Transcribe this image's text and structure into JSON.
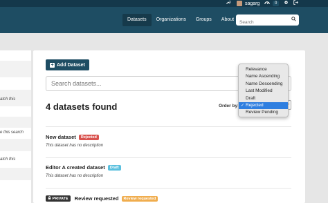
{
  "account": {
    "wrench_icon": "wrench-icon",
    "username": "sagarg",
    "dashboard_count": "0",
    "settings_icon": "gear-icon",
    "logout_icon": "logout-icon"
  },
  "nav": {
    "items": [
      {
        "label": "Datasets",
        "active": true
      },
      {
        "label": "Organizations",
        "active": false
      },
      {
        "label": "Groups",
        "active": false
      },
      {
        "label": "About",
        "active": false
      }
    ],
    "search_placeholder": "Search"
  },
  "sidebar": {
    "texts": [
      "atch this",
      "e this search",
      "atch this"
    ]
  },
  "main": {
    "add_label": "Add Dataset",
    "search_placeholder": "Search datasets...",
    "found_text": "4 datasets found",
    "order_by_label": "Order by:"
  },
  "order_options": [
    {
      "label": "Relevance",
      "selected": false
    },
    {
      "label": "Name Ascending",
      "selected": false
    },
    {
      "label": "Name Descending",
      "selected": false
    },
    {
      "label": "Last Modified",
      "selected": false
    },
    {
      "label": "Draft",
      "selected": false
    },
    {
      "label": "Rejected",
      "selected": true
    },
    {
      "label": "Review Pending",
      "selected": false
    }
  ],
  "datasets": [
    {
      "title": "New dataset",
      "tag": "Rejected",
      "description": "This dataset has no description"
    },
    {
      "title": "Editor A created dataset",
      "tag": "Draft",
      "description": "This dataset has no description"
    },
    {
      "private_label": "PRIVATE",
      "title": "Review requested",
      "tag": "Review requested"
    }
  ],
  "colors": {
    "masthead": "#1e4d63",
    "rejected": "#d9534f",
    "draft": "#5bc0de",
    "review": "#f0ad4e",
    "selected_option": "#2f7fe0"
  }
}
